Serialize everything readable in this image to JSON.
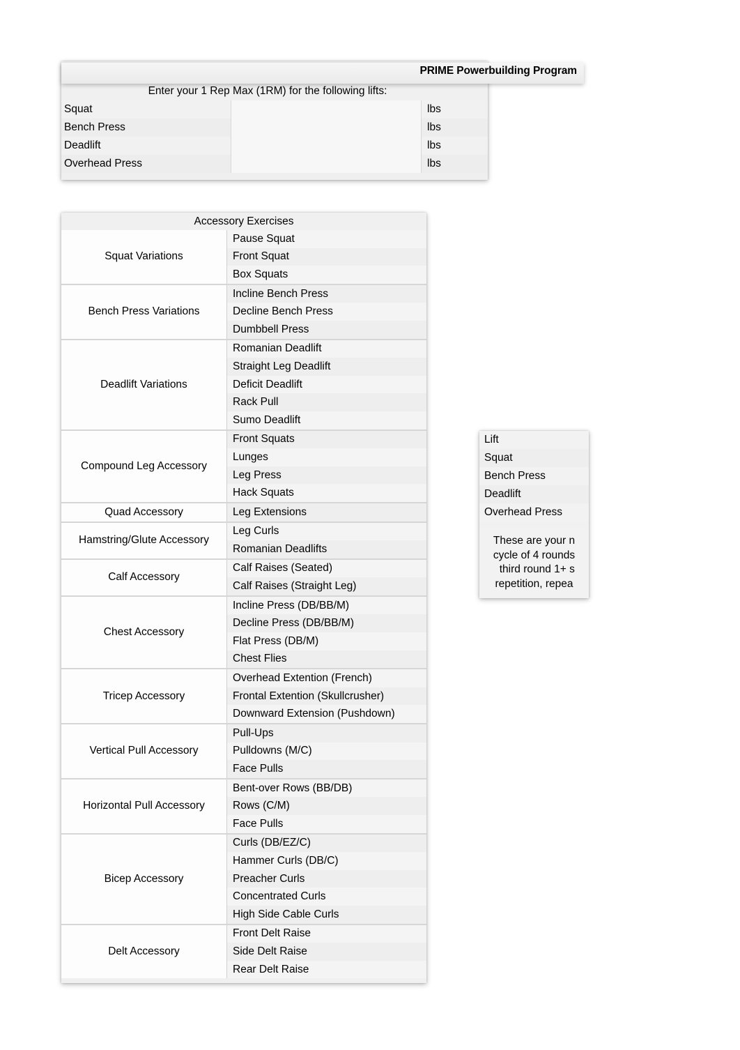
{
  "document": {
    "title": "PRIME Powerbuilding Program"
  },
  "one_rep_max": {
    "instruction": "Enter your 1 Rep Max (1RM) for the following lifts:",
    "unit": "lbs",
    "rows": [
      {
        "lift": "Squat",
        "value": "",
        "unit": "lbs"
      },
      {
        "lift": "Bench Press",
        "value": "",
        "unit": "lbs"
      },
      {
        "lift": "Deadlift",
        "value": "",
        "unit": "lbs"
      },
      {
        "lift": "Overhead Press",
        "value": "",
        "unit": "lbs"
      }
    ]
  },
  "accessory_exercises": {
    "header": "Accessory Exercises",
    "groups": [
      {
        "label": "Squat Variations",
        "items": [
          "Pause Squat",
          "Front Squat",
          "Box Squats"
        ]
      },
      {
        "label": "Bench Press Variations",
        "items": [
          "Incline Bench Press",
          "Decline Bench Press",
          "Dumbbell Press"
        ]
      },
      {
        "label": "Deadlift Variations",
        "items": [
          "Romanian Deadlift",
          "Straight Leg Deadlift",
          "Deficit Deadlift",
          "Rack Pull",
          "Sumo Deadlift"
        ]
      },
      {
        "label": "Compound Leg Accessory",
        "items": [
          "Front Squats",
          "Lunges",
          "Leg Press",
          "Hack Squats"
        ]
      },
      {
        "label": "Quad Accessory",
        "items": [
          "Leg Extensions"
        ]
      },
      {
        "label": "Hamstring/Glute Accessory",
        "items": [
          "Leg Curls",
          "Romanian Deadlifts"
        ]
      },
      {
        "label": "Calf Accessory",
        "items": [
          "Calf Raises (Seated)",
          "Calf Raises (Straight Leg)"
        ]
      },
      {
        "label": "Chest Accessory",
        "items": [
          "Incline Press (DB/BB/M)",
          "Decline Press (DB/BB/M)",
          "Flat Press (DB/M)",
          "Chest Flies"
        ]
      },
      {
        "label": "Tricep Accessory",
        "items": [
          "Overhead Extention (French)",
          "Frontal Extention (Skullcrusher)",
          "Downward Extension (Pushdown)"
        ]
      },
      {
        "label": "Vertical Pull Accessory",
        "items": [
          "Pull-Ups",
          "Pulldowns (M/C)",
          "Face Pulls"
        ]
      },
      {
        "label": "Horizontal Pull Accessory",
        "items": [
          "Bent-over Rows (BB/DB)",
          "Rows (C/M)",
          "Face Pulls"
        ]
      },
      {
        "label": "Bicep Accessory",
        "items": [
          "Curls (DB/EZ/C)",
          "Hammer Curls (DB/C)",
          "Preacher Curls",
          "Concentrated Curls",
          "High Side Cable Curls"
        ]
      },
      {
        "label": "Delt Accessory",
        "items": [
          "Front Delt Raise",
          "Side Delt Raise",
          "Rear Delt Raise"
        ]
      }
    ]
  },
  "lift_reference": {
    "header": "Lift",
    "lifts": [
      "Squat",
      "Bench Press",
      "Deadlift",
      "Overhead Press"
    ],
    "note": "These are your n\ncycle of 4 rounds\n  third round 1+ s\nrepetition, repea"
  }
}
